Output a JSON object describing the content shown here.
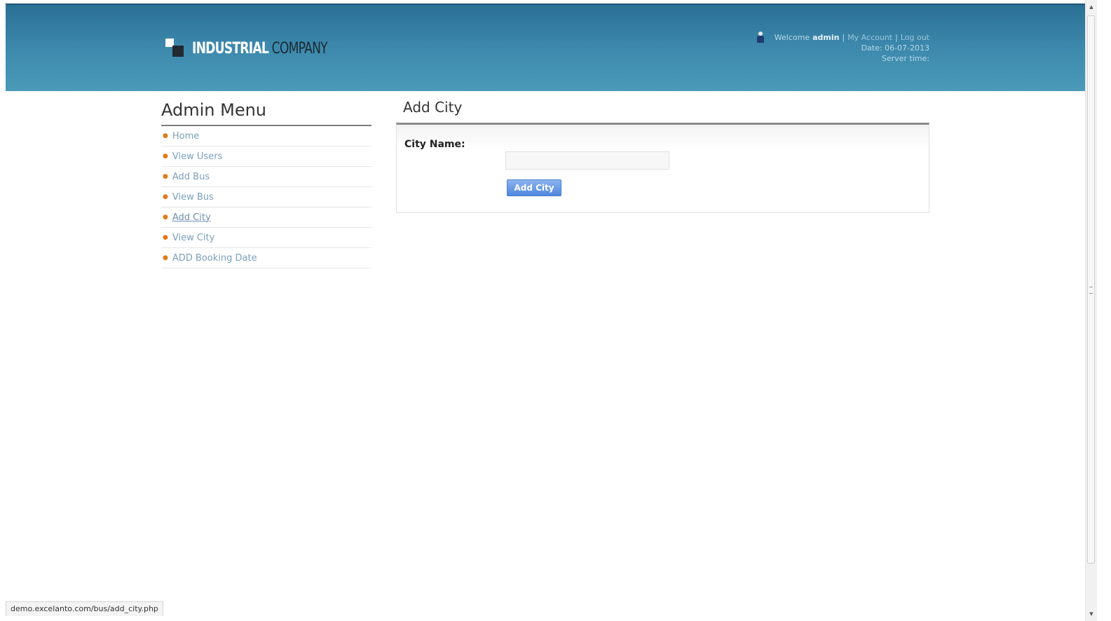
{
  "header": {
    "logo": {
      "word1": "INDUSTRIAL",
      "word2": "COMPANY"
    },
    "user": {
      "welcome_prefix": "Welcome",
      "username": "admin",
      "separator": "|",
      "my_account": "My Account",
      "logout": "Log out",
      "date_line": "Date: 06-07-2013",
      "server_time_line": "Server time:"
    }
  },
  "sidebar": {
    "title": "Admin Menu",
    "items": [
      {
        "label": "Home"
      },
      {
        "label": "View Users"
      },
      {
        "label": "Add Bus"
      },
      {
        "label": "View Bus"
      },
      {
        "label": "Add City",
        "active": true
      },
      {
        "label": "View City"
      },
      {
        "label": "ADD Booking Date"
      }
    ]
  },
  "main": {
    "title": "Add City",
    "form": {
      "city_label": "City Name:",
      "city_value": "",
      "submit_label": "Add City"
    }
  },
  "statusbar": {
    "url": "demo.excelanto.com/bus/add_city.php"
  },
  "colors": {
    "header": "#3d89ad",
    "menu_link": "#7aa0be",
    "bullet": "#e07b1a",
    "button": "#4f86dc"
  }
}
